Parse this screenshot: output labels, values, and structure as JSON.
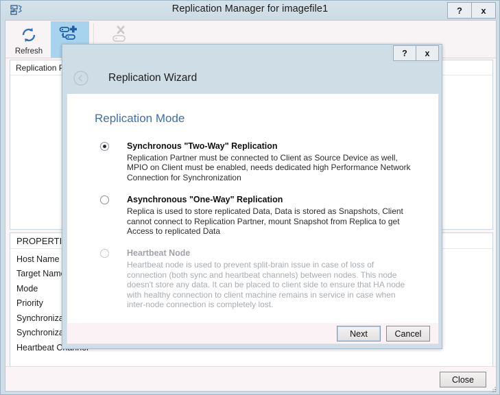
{
  "window": {
    "title": "Replication Manager for imagefile1",
    "icon": "server-config-icon",
    "help_label": "?",
    "close_label": "x",
    "footer": {
      "close_button": "Close"
    }
  },
  "toolbar": {
    "items": [
      {
        "label": "Refresh",
        "icon": "refresh-icon",
        "state": "enabled"
      },
      {
        "label": "Add",
        "icon": "add-partner-icon",
        "state": "selected"
      },
      {
        "label": "",
        "icon": "remove-partner-icon",
        "state": "disabled"
      }
    ]
  },
  "partners_list": {
    "columns": [
      "Replication Partner"
    ],
    "rows": []
  },
  "properties": {
    "title": "PROPERTIES",
    "rows": [
      {
        "key": "Host Name",
        "value": ""
      },
      {
        "key": "Target Name",
        "value": ""
      },
      {
        "key": "Mode",
        "value": ""
      },
      {
        "key": "Priority",
        "value": ""
      },
      {
        "key": "Synchronization Channel",
        "value": ""
      },
      {
        "key": "Synchronization Status",
        "value": ""
      },
      {
        "key": "Heartbeat Channel",
        "value": ""
      }
    ]
  },
  "dialog": {
    "help_label": "?",
    "close_label": "x",
    "back_icon": "back-circle-icon",
    "header_title": "Replication Wizard",
    "heading": "Replication Mode",
    "options": [
      {
        "title": "Synchronous \"Two-Way\" Replication",
        "description": "Replication Partner must be connected to Client as Source Device as well, MPIO on Client must be enabled, needs dedicated high Performance Network Connection for Synchronization",
        "selected": true,
        "disabled": false
      },
      {
        "title": "Asynchronous \"One-Way\" Replication",
        "description": "Replica is used to store replicated Data, Data is stored as Snapshots, Client cannot connect to Replication Partner, mount Snapshot from Replica to get Access to replicated Data",
        "selected": false,
        "disabled": false
      },
      {
        "title": "Heartbeat Node",
        "description": "Heartbeat node is used to prevent split-brain issue in case of loss of connection (both sync and heartbeat channels) between nodes. This node doesn't store any data. It can be placed to client side to ensure that HA node with healthy connection to client machine remains in service in case when inter-node connection is completely lost.",
        "selected": false,
        "disabled": true
      }
    ],
    "buttons": {
      "next": "Next",
      "cancel": "Cancel"
    }
  },
  "colors": {
    "accent_heading": "#3f6fa8",
    "selected_toolbar": "#a8d3ef",
    "window_chrome": "#cfdde6"
  }
}
